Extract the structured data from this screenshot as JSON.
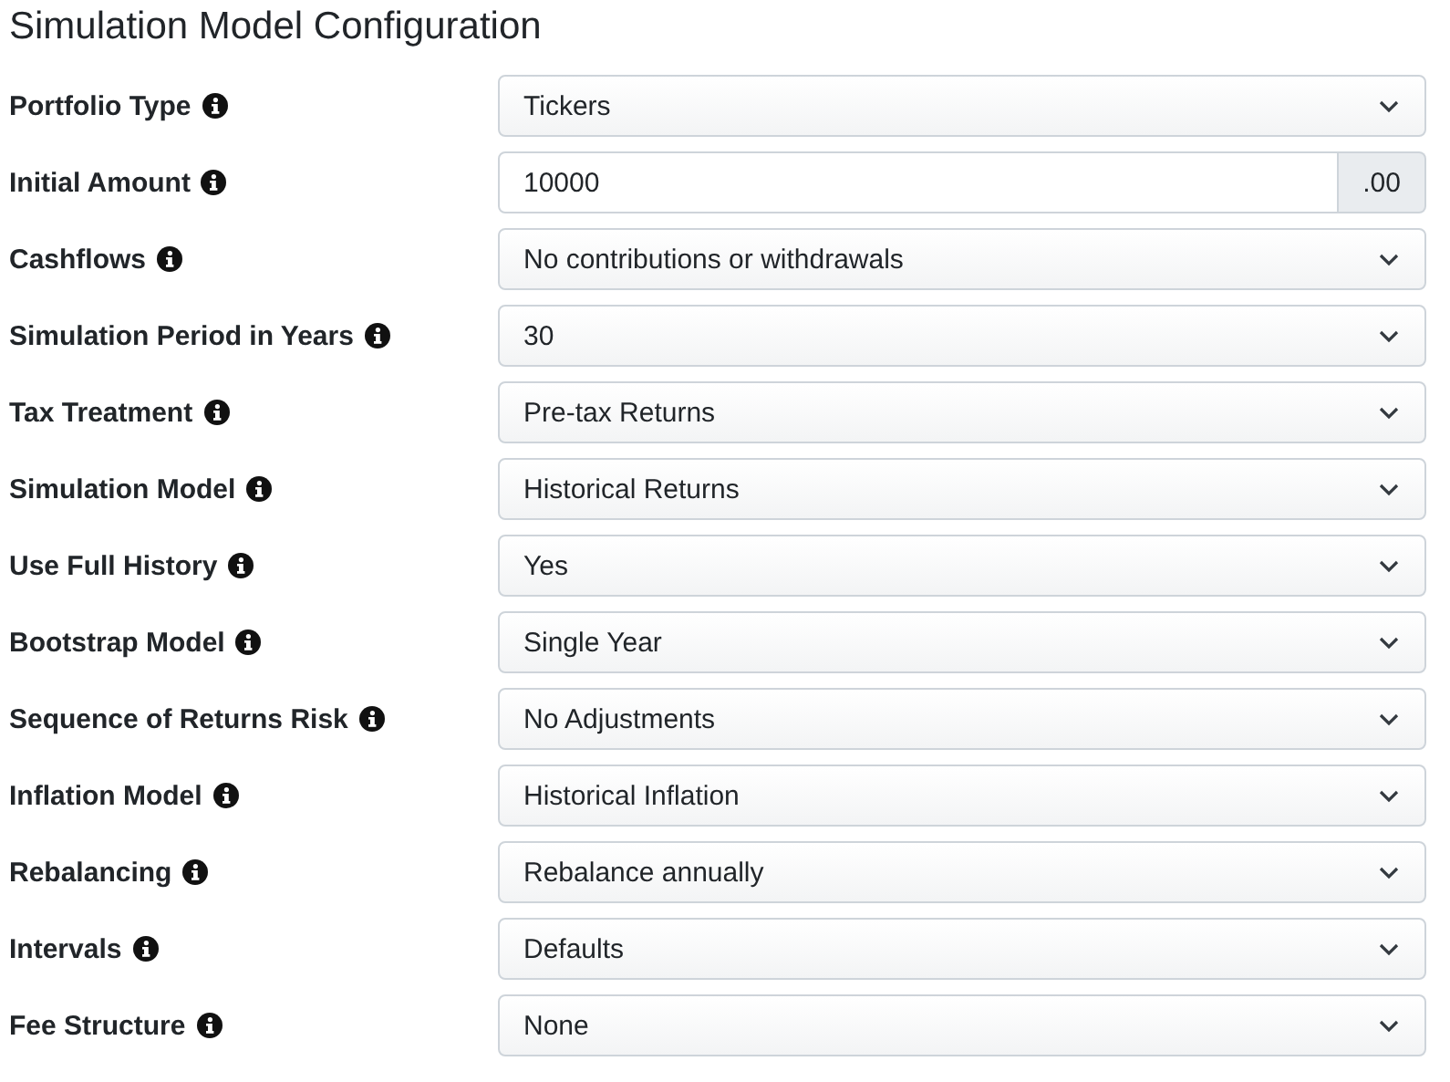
{
  "title": "Simulation Model Configuration",
  "fields": [
    {
      "label": "Portfolio Type",
      "kind": "select",
      "value": "Tickers"
    },
    {
      "label": "Initial Amount",
      "kind": "amount",
      "value": "10000",
      "addon": ".00"
    },
    {
      "label": "Cashflows",
      "kind": "select",
      "value": "No contributions or withdrawals"
    },
    {
      "label": "Simulation Period in Years",
      "kind": "select",
      "value": "30"
    },
    {
      "label": "Tax Treatment",
      "kind": "select",
      "value": "Pre-tax Returns"
    },
    {
      "label": "Simulation Model",
      "kind": "select",
      "value": "Historical Returns"
    },
    {
      "label": "Use Full History",
      "kind": "select",
      "value": "Yes"
    },
    {
      "label": "Bootstrap Model",
      "kind": "select",
      "value": "Single Year"
    },
    {
      "label": "Sequence of Returns Risk",
      "kind": "select",
      "value": "No Adjustments"
    },
    {
      "label": "Inflation Model",
      "kind": "select",
      "value": "Historical Inflation"
    },
    {
      "label": "Rebalancing",
      "kind": "select",
      "value": "Rebalance annually"
    },
    {
      "label": "Intervals",
      "kind": "select",
      "value": "Defaults"
    },
    {
      "label": "Fee Structure",
      "kind": "select",
      "value": "None"
    }
  ]
}
